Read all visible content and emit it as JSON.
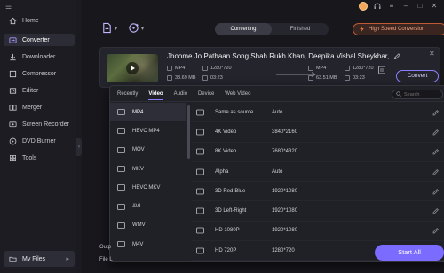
{
  "sidebar": {
    "home": "Home",
    "items": [
      {
        "label": "Converter",
        "icon": "converter-icon",
        "active": true
      },
      {
        "label": "Downloader",
        "icon": "downloader-icon"
      },
      {
        "label": "Compressor",
        "icon": "compressor-icon"
      },
      {
        "label": "Editor",
        "icon": "editor-icon"
      },
      {
        "label": "Merger",
        "icon": "merger-icon"
      },
      {
        "label": "Screen Recorder",
        "icon": "screen-recorder-icon"
      },
      {
        "label": "DVD Burner",
        "icon": "dvd-icon"
      },
      {
        "label": "Tools",
        "icon": "tools-icon"
      }
    ],
    "my_files": "My Files"
  },
  "toolbar": {
    "tabs": [
      "Converting",
      "Finished"
    ],
    "active_tab": "Converting",
    "high_speed": "High Speed Conversion"
  },
  "file": {
    "title": "Jhoome Jo Pathaan Song  Shah Rukh Khan, Deepika  Vishal  Sheykhar, ...",
    "src": {
      "format": "MP4",
      "resolution": "1280*720",
      "size": "33.69 MB",
      "duration": "03:23"
    },
    "dst": {
      "format": "MP4",
      "resolution": "1280*720",
      "size": "63.51 MB",
      "duration": "03:23"
    },
    "convert_label": "Convert"
  },
  "popup": {
    "tabs": [
      "Recently",
      "Video",
      "Audio",
      "Device",
      "Web Video"
    ],
    "active_tab": "Video",
    "search_placeholder": "Search",
    "formats": [
      "MP4",
      "HEVC MP4",
      "MOV",
      "MKV",
      "HEVC MKV",
      "AVI",
      "WMV",
      "M4V"
    ],
    "active_format": "MP4",
    "resolutions": [
      {
        "name": "Same as source",
        "value": "Auto"
      },
      {
        "name": "4K Video",
        "value": "3840*2160"
      },
      {
        "name": "8K Video",
        "value": "7680*4320"
      },
      {
        "name": "Alpha",
        "value": "Auto"
      },
      {
        "name": "3D Red-Blue",
        "value": "1920*1080"
      },
      {
        "name": "3D Left-Right",
        "value": "1920*1080"
      },
      {
        "name": "HD 1080P",
        "value": "1920*1080"
      },
      {
        "name": "HD 720P",
        "value": "1280*720"
      }
    ]
  },
  "bottom": {
    "output_label": "Outp",
    "location_label": "File L",
    "start_all": "Start All"
  },
  "colors": {
    "accent": "#7b6bff",
    "warning": "#c05a35",
    "avatar": "#f4a75b"
  }
}
